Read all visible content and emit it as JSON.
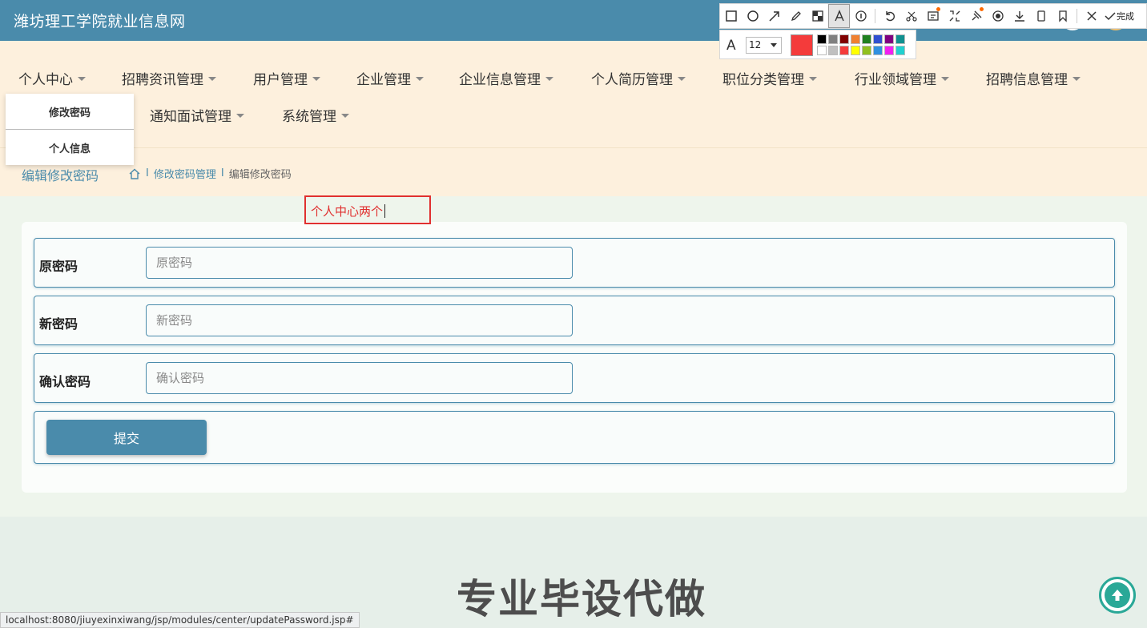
{
  "header": {
    "site_title": "潍坊理工学院就业信息网"
  },
  "nav": {
    "items": [
      {
        "label": "个人中心"
      },
      {
        "label": "招聘资讯管理"
      },
      {
        "label": "用户管理"
      },
      {
        "label": "企业管理"
      },
      {
        "label": "企业信息管理"
      },
      {
        "label": "个人简历管理"
      },
      {
        "label": "职位分类管理"
      },
      {
        "label": "行业领域管理"
      },
      {
        "label": "招聘信息管理"
      },
      {
        "label": "通知面试管理"
      },
      {
        "label": "系统管理"
      }
    ],
    "dropdown": [
      {
        "label": "修改密码"
      },
      {
        "label": "个人信息"
      }
    ]
  },
  "breadcrumb": {
    "title": "编辑修改密码",
    "items": [
      "修改密码管理",
      "编辑修改密码"
    ],
    "separator": "I"
  },
  "annotation": {
    "text": "个人中心两个",
    "color": "#e0302f"
  },
  "form": {
    "fields": [
      {
        "label": "原密码",
        "placeholder": "原密码"
      },
      {
        "label": "新密码",
        "placeholder": "新密码"
      },
      {
        "label": "确认密码",
        "placeholder": "确认密码"
      }
    ],
    "submit_label": "提交"
  },
  "watermark": "专业毕设代做",
  "status_url": "localhost:8080/jiuyexinxiwang/jsp/modules/center/updatePassword.jsp#",
  "screenshot_tool": {
    "tools": [
      "rectangle-icon",
      "ellipse-icon",
      "arrow-icon",
      "pencil-icon",
      "mosaic-icon",
      "text-icon",
      "number-icon",
      "undo-icon",
      "cut-icon",
      "ocr-icon",
      "translate-icon",
      "pin-icon",
      "record-icon",
      "download-icon",
      "phone-icon",
      "bookmark-icon",
      "close-icon"
    ],
    "done_label": "完成",
    "font_size": "12",
    "current_color": "#f43b3b",
    "palette": [
      "#000000",
      "#808080",
      "#800000",
      "#f08030",
      "#208020",
      "#3050d0",
      "#800080",
      "#109090",
      "#ffffff",
      "#c0c0c0",
      "#f43b3b",
      "#ffff00",
      "#90c020",
      "#3090e0",
      "#f020f0",
      "#20d0d0"
    ]
  },
  "colors": {
    "primary": "#4a8bab",
    "nav_bg": "#fdf0dd",
    "back_top": "#2aa897"
  }
}
